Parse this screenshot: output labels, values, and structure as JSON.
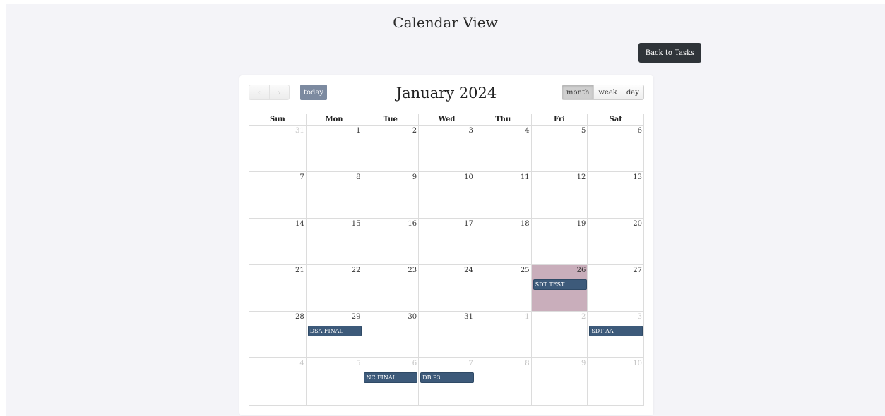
{
  "page": {
    "title": "Calendar View"
  },
  "header": {
    "back_label": "Back to Tasks"
  },
  "toolbar": {
    "prev_icon": "‹",
    "next_icon": "›",
    "today_label": "today",
    "title": "January 2024",
    "views": [
      "month",
      "week",
      "day"
    ],
    "active_view": "month"
  },
  "calendar": {
    "weekdays": [
      "Sun",
      "Mon",
      "Tue",
      "Wed",
      "Thu",
      "Fri",
      "Sat"
    ],
    "highlight_color": "#c9aebb",
    "event_color": "#3d5a7a",
    "weeks": [
      [
        {
          "day": "31",
          "other": true
        },
        {
          "day": "1"
        },
        {
          "day": "2"
        },
        {
          "day": "3"
        },
        {
          "day": "4"
        },
        {
          "day": "5"
        },
        {
          "day": "6"
        }
      ],
      [
        {
          "day": "7"
        },
        {
          "day": "8"
        },
        {
          "day": "9"
        },
        {
          "day": "10"
        },
        {
          "day": "11"
        },
        {
          "day": "12"
        },
        {
          "day": "13"
        }
      ],
      [
        {
          "day": "14"
        },
        {
          "day": "15"
        },
        {
          "day": "16"
        },
        {
          "day": "17"
        },
        {
          "day": "18"
        },
        {
          "day": "19"
        },
        {
          "day": "20"
        }
      ],
      [
        {
          "day": "21"
        },
        {
          "day": "22"
        },
        {
          "day": "23"
        },
        {
          "day": "24"
        },
        {
          "day": "25"
        },
        {
          "day": "26",
          "highlight": true,
          "event": "SDT TEST"
        },
        {
          "day": "27"
        }
      ],
      [
        {
          "day": "28"
        },
        {
          "day": "29",
          "event": "DSA FINAL"
        },
        {
          "day": "30"
        },
        {
          "day": "31"
        },
        {
          "day": "1",
          "other": true
        },
        {
          "day": "2",
          "other": true
        },
        {
          "day": "3",
          "other": true,
          "event": "SDT AA"
        }
      ],
      [
        {
          "day": "4",
          "other": true
        },
        {
          "day": "5",
          "other": true
        },
        {
          "day": "6",
          "other": true,
          "event": "NC FINAL"
        },
        {
          "day": "7",
          "other": true,
          "event": "DB P3"
        },
        {
          "day": "8",
          "other": true
        },
        {
          "day": "9",
          "other": true
        },
        {
          "day": "10",
          "other": true
        }
      ]
    ]
  }
}
